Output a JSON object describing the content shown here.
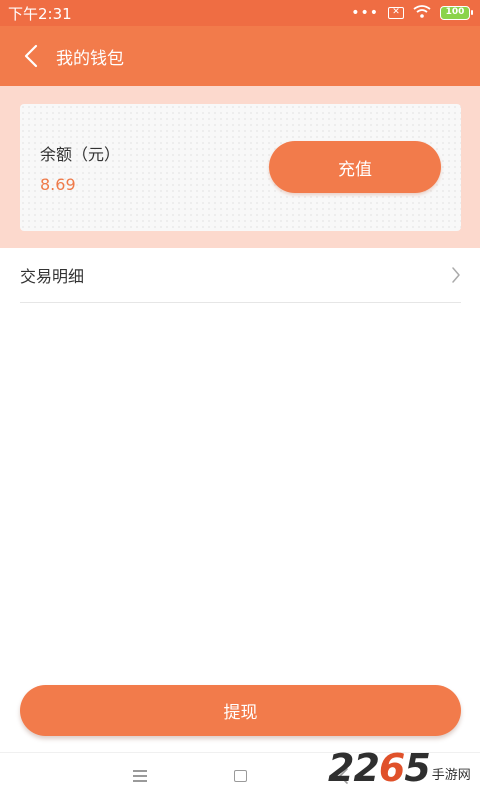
{
  "status_bar": {
    "time": "下午2:31",
    "dots": "•••",
    "sim": "✕",
    "battery": "100"
  },
  "nav": {
    "title": "我的钱包",
    "back_icon": "chevron-left-icon"
  },
  "balance_card": {
    "label": "余额（元）",
    "value": "8.69",
    "recharge_label": "充值"
  },
  "transactions": {
    "label": "交易明细",
    "chevron_icon": "chevron-right-icon"
  },
  "withdraw": {
    "label": "提现"
  },
  "watermark": {
    "number_a": "22",
    "number_b": "6",
    "number_c": "5",
    "text": "手游网"
  },
  "colors": {
    "accent": "#f27b4b",
    "statusbar": "#ef6d43",
    "card_band": "#fcd9cd",
    "balance_value": "#ef7a49"
  }
}
